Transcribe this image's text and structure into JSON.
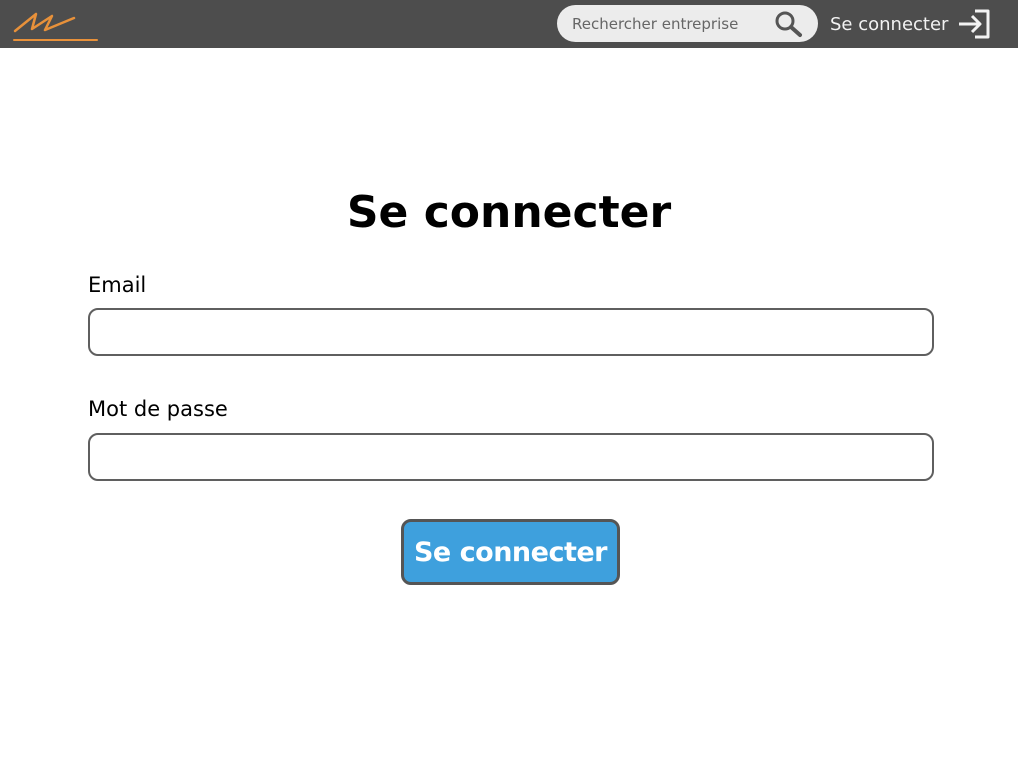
{
  "header": {
    "logo_icon": "brand-logo-icon",
    "brand_color": "#e8913a",
    "background": "#4d4d4d",
    "search": {
      "placeholder": "Rechercher entreprise",
      "value": "",
      "icon": "search-icon"
    },
    "login_link": {
      "label": "Se connecter",
      "icon": "login-arrow-icon"
    }
  },
  "form": {
    "title": "Se connecter",
    "email_label": "Email",
    "email_value": "",
    "password_label": "Mot de passe",
    "password_value": "",
    "submit_label": "Se connecter",
    "submit_color": "#3ea0dd"
  }
}
